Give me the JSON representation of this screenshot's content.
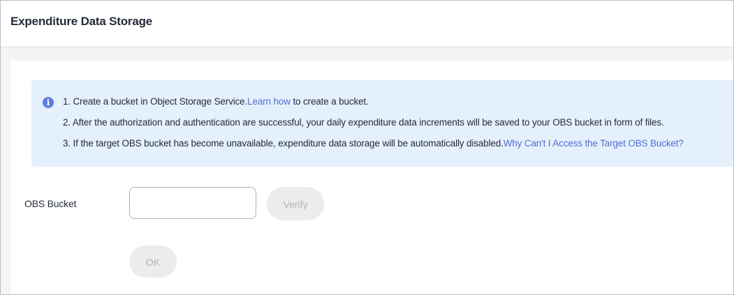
{
  "header": {
    "title": "Expenditure Data Storage"
  },
  "notice": {
    "icon": "info-icon",
    "icon_color": "#5e7ce0",
    "background_color": "#e5f0fd",
    "line1": {
      "prefix": "1. Create a bucket in Object Storage Service.",
      "link": "Learn how",
      "suffix": " to create a bucket."
    },
    "line2": "2. After the authorization and authentication are successful, your daily expenditure data increments will be saved to your OBS bucket in form of files.",
    "line3": {
      "prefix": "3. If the target OBS bucket has become unavailable, expenditure data storage will be automatically disabled.",
      "link": "Why Can't I Access the Target OBS Bucket?"
    },
    "link_color": "#526ecc"
  },
  "form": {
    "bucket_label": "OBS Bucket",
    "bucket_value": "",
    "bucket_placeholder": "",
    "verify_label": "Verify",
    "ok_label": "OK"
  }
}
